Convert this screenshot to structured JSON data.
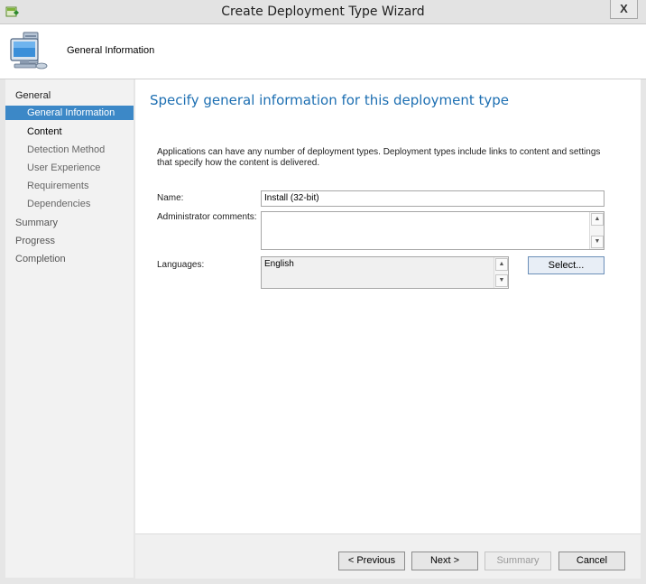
{
  "window": {
    "title": "Create Deployment Type Wizard",
    "close_label": "X"
  },
  "banner": {
    "title": "General Information",
    "icon": "computer-icon"
  },
  "sidebar": {
    "items": [
      {
        "label": "General",
        "kind": "section"
      },
      {
        "label": "General Information",
        "kind": "sub",
        "active": true
      },
      {
        "label": "Content",
        "kind": "sub"
      },
      {
        "label": "Detection Method",
        "kind": "sub"
      },
      {
        "label": "User Experience",
        "kind": "sub"
      },
      {
        "label": "Requirements",
        "kind": "sub"
      },
      {
        "label": "Dependencies",
        "kind": "sub"
      },
      {
        "label": "Summary",
        "kind": "section"
      },
      {
        "label": "Progress",
        "kind": "section"
      },
      {
        "label": "Completion",
        "kind": "section"
      }
    ]
  },
  "main": {
    "heading": "Specify general information for this deployment type",
    "description": "Applications can have any number of deployment types. Deployment types include links to content and settings that specify how the content is delivered.",
    "name_label": "Name:",
    "name_value": "Install (32-bit)",
    "admin_comments_label": "Administrator comments:",
    "admin_comments_value": "",
    "languages_label": "Languages:",
    "languages_value": "English",
    "select_button": "Select..."
  },
  "footer": {
    "previous": "< Previous",
    "next": "Next >",
    "summary": "Summary",
    "cancel": "Cancel"
  },
  "colors": {
    "accent": "#3c88c7",
    "heading": "#1d6fb2"
  }
}
